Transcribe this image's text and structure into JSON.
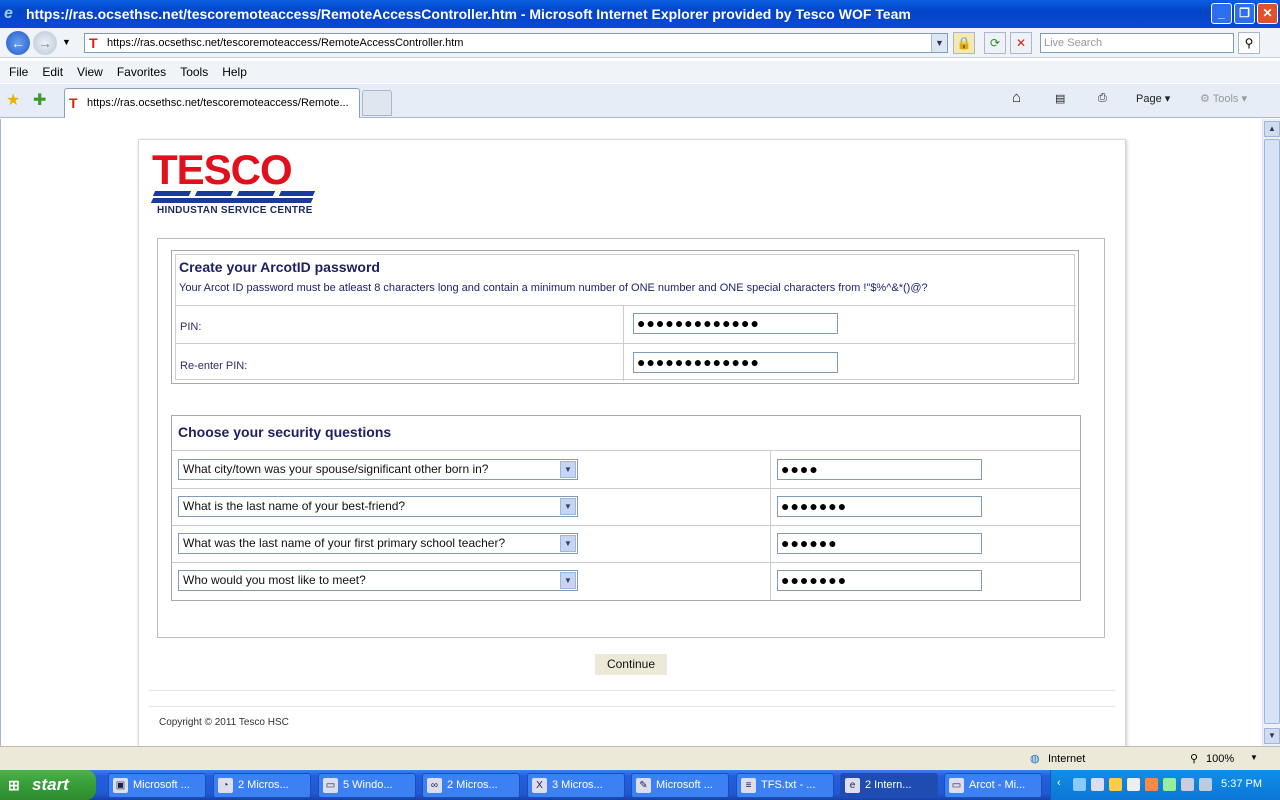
{
  "window": {
    "title": "https://ras.ocsethsc.net/tescoremoteaccess/RemoteAccessController.htm - Microsoft Internet Explorer provided by Tesco WOF Team"
  },
  "toolbar": {
    "address": "https://ras.ocsethsc.net/tescoremoteaccess/RemoteAccessController.htm",
    "search_placeholder": "Live Search"
  },
  "menu": [
    "File",
    "Edit",
    "View",
    "Favorites",
    "Tools",
    "Help"
  ],
  "tab": {
    "title": "https://ras.ocsethsc.net/tescoremoteaccess/Remote..."
  },
  "commandbar": {
    "page": "Page",
    "tools": "Tools"
  },
  "page": {
    "logo_word": "TESCO",
    "logo_sub": "HINDUSTAN SERVICE CENTRE",
    "password_section": {
      "heading": "Create your ArcotID password",
      "hint": "Your Arcot ID password must be atleast 8 characters long and contain a minimum number of ONE number and ONE special characters from !\"$%^&*()@?",
      "pin_label": "PIN:",
      "pin_value": "●●●●●●●●●●●●●",
      "reenter_label": "Re-enter PIN:",
      "reenter_value": "●●●●●●●●●●●●●"
    },
    "security_section": {
      "heading": "Choose your security questions",
      "questions": [
        {
          "question": "What city/town was your spouse/significant other born in?",
          "answer": "●●●●"
        },
        {
          "question": "What is the last name of your best-friend?",
          "answer": "●●●●●●●"
        },
        {
          "question": "What was the last name of your first primary school teacher?",
          "answer": "●●●●●●"
        },
        {
          "question": "Who would you most like to meet?",
          "answer": "●●●●●●●"
        }
      ]
    },
    "continue_label": "Continue",
    "copyright": "Copyright © 2011 Tesco HSC"
  },
  "statusbar": {
    "zone": "Internet",
    "zoom": "100%"
  },
  "taskbar": {
    "start": "start",
    "buttons": [
      "Microsoft ...",
      "2 Micros...",
      "5 Windo...",
      "2 Micros...",
      "3 Micros...",
      "Microsoft ...",
      "TFS.txt - ...",
      "2 Intern...",
      "Arcot - Mi..."
    ],
    "clock": "5:37 PM"
  },
  "colors": {
    "tesco_red": "#e0101c",
    "tesco_blue": "#1a3a9c",
    "heading_navy": "#1d2160"
  }
}
